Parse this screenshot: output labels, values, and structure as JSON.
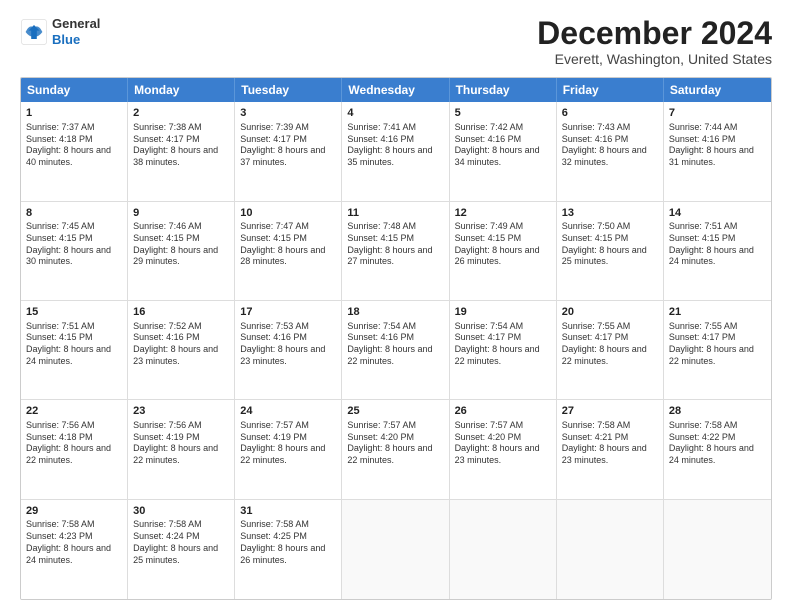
{
  "logo": {
    "general": "General",
    "blue": "Blue"
  },
  "title": "December 2024",
  "location": "Everett, Washington, United States",
  "days": [
    "Sunday",
    "Monday",
    "Tuesday",
    "Wednesday",
    "Thursday",
    "Friday",
    "Saturday"
  ],
  "weeks": [
    [
      {
        "day": "1",
        "sunrise": "7:37 AM",
        "sunset": "4:18 PM",
        "daylight": "8 hours and 40 minutes."
      },
      {
        "day": "2",
        "sunrise": "7:38 AM",
        "sunset": "4:17 PM",
        "daylight": "8 hours and 38 minutes."
      },
      {
        "day": "3",
        "sunrise": "7:39 AM",
        "sunset": "4:17 PM",
        "daylight": "8 hours and 37 minutes."
      },
      {
        "day": "4",
        "sunrise": "7:41 AM",
        "sunset": "4:16 PM",
        "daylight": "8 hours and 35 minutes."
      },
      {
        "day": "5",
        "sunrise": "7:42 AM",
        "sunset": "4:16 PM",
        "daylight": "8 hours and 34 minutes."
      },
      {
        "day": "6",
        "sunrise": "7:43 AM",
        "sunset": "4:16 PM",
        "daylight": "8 hours and 32 minutes."
      },
      {
        "day": "7",
        "sunrise": "7:44 AM",
        "sunset": "4:16 PM",
        "daylight": "8 hours and 31 minutes."
      }
    ],
    [
      {
        "day": "8",
        "sunrise": "7:45 AM",
        "sunset": "4:15 PM",
        "daylight": "8 hours and 30 minutes."
      },
      {
        "day": "9",
        "sunrise": "7:46 AM",
        "sunset": "4:15 PM",
        "daylight": "8 hours and 29 minutes."
      },
      {
        "day": "10",
        "sunrise": "7:47 AM",
        "sunset": "4:15 PM",
        "daylight": "8 hours and 28 minutes."
      },
      {
        "day": "11",
        "sunrise": "7:48 AM",
        "sunset": "4:15 PM",
        "daylight": "8 hours and 27 minutes."
      },
      {
        "day": "12",
        "sunrise": "7:49 AM",
        "sunset": "4:15 PM",
        "daylight": "8 hours and 26 minutes."
      },
      {
        "day": "13",
        "sunrise": "7:50 AM",
        "sunset": "4:15 PM",
        "daylight": "8 hours and 25 minutes."
      },
      {
        "day": "14",
        "sunrise": "7:51 AM",
        "sunset": "4:15 PM",
        "daylight": "8 hours and 24 minutes."
      }
    ],
    [
      {
        "day": "15",
        "sunrise": "7:51 AM",
        "sunset": "4:15 PM",
        "daylight": "8 hours and 24 minutes."
      },
      {
        "day": "16",
        "sunrise": "7:52 AM",
        "sunset": "4:16 PM",
        "daylight": "8 hours and 23 minutes."
      },
      {
        "day": "17",
        "sunrise": "7:53 AM",
        "sunset": "4:16 PM",
        "daylight": "8 hours and 23 minutes."
      },
      {
        "day": "18",
        "sunrise": "7:54 AM",
        "sunset": "4:16 PM",
        "daylight": "8 hours and 22 minutes."
      },
      {
        "day": "19",
        "sunrise": "7:54 AM",
        "sunset": "4:17 PM",
        "daylight": "8 hours and 22 minutes."
      },
      {
        "day": "20",
        "sunrise": "7:55 AM",
        "sunset": "4:17 PM",
        "daylight": "8 hours and 22 minutes."
      },
      {
        "day": "21",
        "sunrise": "7:55 AM",
        "sunset": "4:17 PM",
        "daylight": "8 hours and 22 minutes."
      }
    ],
    [
      {
        "day": "22",
        "sunrise": "7:56 AM",
        "sunset": "4:18 PM",
        "daylight": "8 hours and 22 minutes."
      },
      {
        "day": "23",
        "sunrise": "7:56 AM",
        "sunset": "4:19 PM",
        "daylight": "8 hours and 22 minutes."
      },
      {
        "day": "24",
        "sunrise": "7:57 AM",
        "sunset": "4:19 PM",
        "daylight": "8 hours and 22 minutes."
      },
      {
        "day": "25",
        "sunrise": "7:57 AM",
        "sunset": "4:20 PM",
        "daylight": "8 hours and 22 minutes."
      },
      {
        "day": "26",
        "sunrise": "7:57 AM",
        "sunset": "4:20 PM",
        "daylight": "8 hours and 23 minutes."
      },
      {
        "day": "27",
        "sunrise": "7:58 AM",
        "sunset": "4:21 PM",
        "daylight": "8 hours and 23 minutes."
      },
      {
        "day": "28",
        "sunrise": "7:58 AM",
        "sunset": "4:22 PM",
        "daylight": "8 hours and 24 minutes."
      }
    ],
    [
      {
        "day": "29",
        "sunrise": "7:58 AM",
        "sunset": "4:23 PM",
        "daylight": "8 hours and 24 minutes."
      },
      {
        "day": "30",
        "sunrise": "7:58 AM",
        "sunset": "4:24 PM",
        "daylight": "8 hours and 25 minutes."
      },
      {
        "day": "31",
        "sunrise": "7:58 AM",
        "sunset": "4:25 PM",
        "daylight": "8 hours and 26 minutes."
      },
      null,
      null,
      null,
      null
    ]
  ]
}
